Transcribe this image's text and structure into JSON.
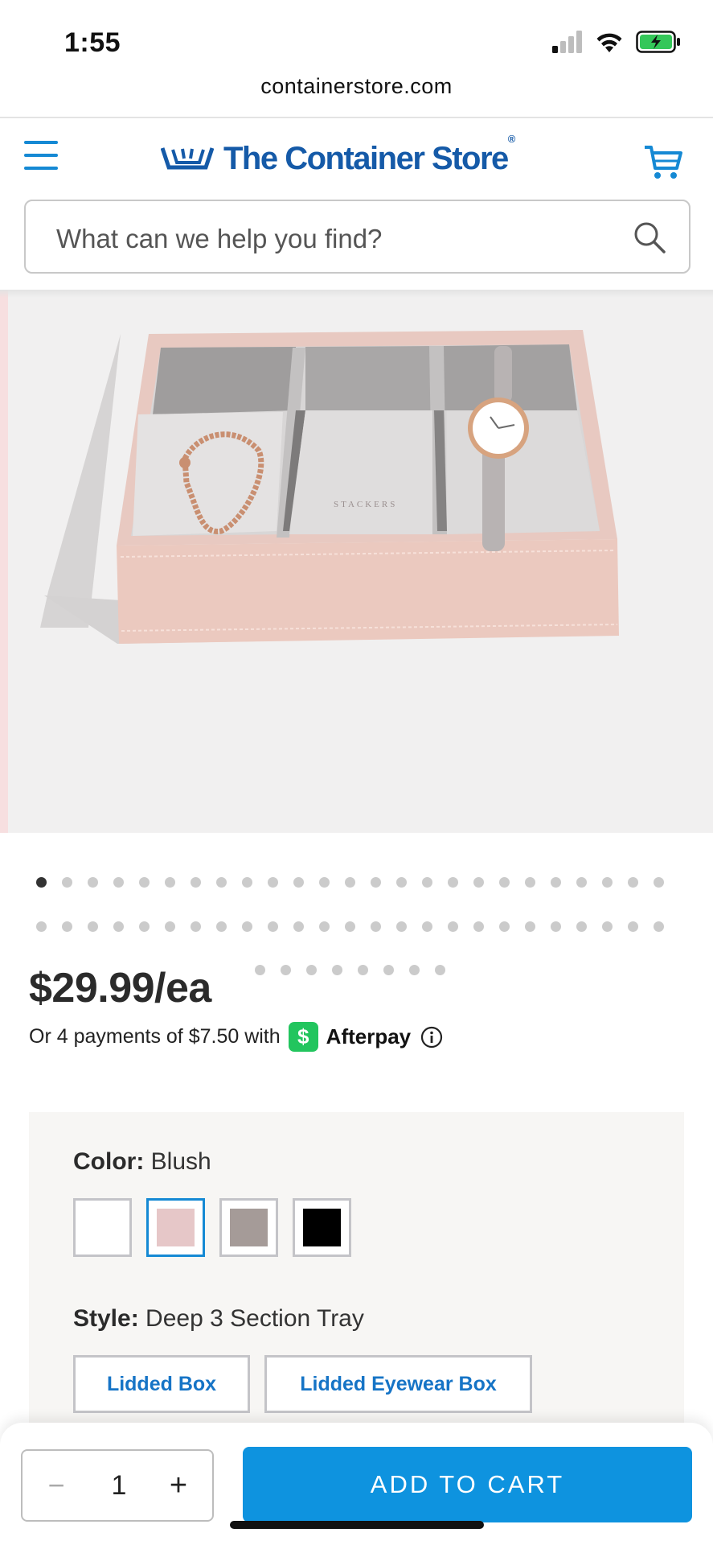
{
  "status_bar": {
    "time": "1:55"
  },
  "browser": {
    "url": "containerstore.com"
  },
  "header": {
    "logo_text": "The Container Store",
    "logo_mark": "®"
  },
  "search": {
    "placeholder": "What can we help you find?"
  },
  "product_image": {
    "alt": "Stackers blush deep 3 section tray",
    "engraving": "STACKERS"
  },
  "carousel": {
    "row1_dots": 25,
    "row2_dots": 25,
    "row3_dots": 8,
    "active_index": 0
  },
  "price": {
    "amount": "$29.99/ea",
    "installment_text": "Or 4 payments of $7.50 with",
    "afterpay_symbol": "$",
    "afterpay_name": "Afterpay"
  },
  "options": {
    "color_label": "Color:",
    "color_value": "Blush",
    "swatches": [
      {
        "name": "White",
        "color": "#ffffff",
        "selected": false
      },
      {
        "name": "Blush",
        "color": "#e6c7c8",
        "selected": true
      },
      {
        "name": "Taupe",
        "color": "#a59b98",
        "selected": false
      },
      {
        "name": "Black",
        "color": "#000000",
        "selected": false
      }
    ],
    "style_label": "Style:",
    "style_value": "Deep 3 Section Tray",
    "style_buttons": [
      "Lidded Box",
      "Lidded Eyewear Box"
    ]
  },
  "cart_bar": {
    "minus": "−",
    "quantity": "1",
    "plus": "+",
    "add_to_cart": "ADD TO CART"
  },
  "colors": {
    "brand_blue": "#155aa8",
    "accent_blue": "#0e93df",
    "afterpay_green": "#22c55e"
  }
}
